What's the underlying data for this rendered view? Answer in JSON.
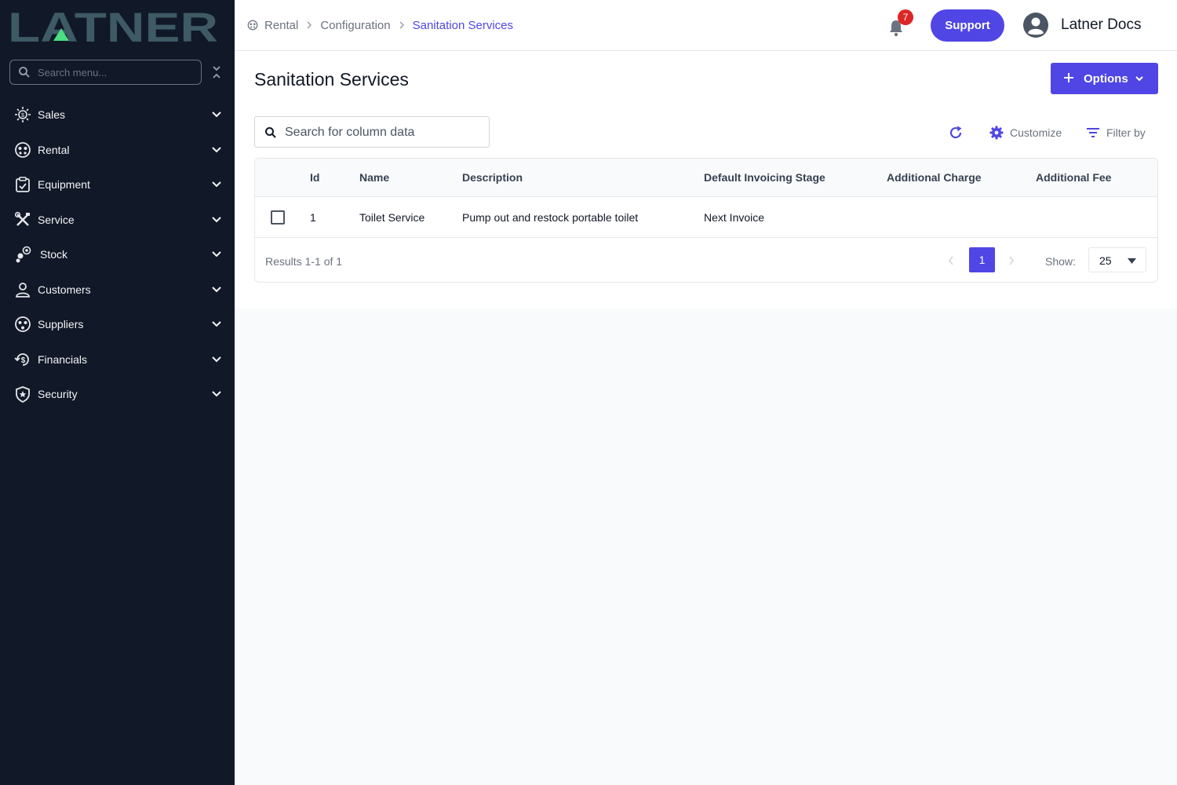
{
  "app": {
    "logo_text": "LATNER"
  },
  "colors": {
    "sidebar_bg": "#111827",
    "accent": "#4f46e5",
    "badge": "#dc2626",
    "logo": "#3d5a65",
    "logo_accent": "#4ade80"
  },
  "sidebar": {
    "search_placeholder": "Search menu...",
    "items": [
      {
        "label": "Sales",
        "icon": "sales-icon"
      },
      {
        "label": "Rental",
        "icon": "rental-icon"
      },
      {
        "label": "Equipment",
        "icon": "equipment-icon"
      },
      {
        "label": "Service",
        "icon": "service-tools-icon"
      },
      {
        "label": "Stock",
        "icon": "stock-icon"
      },
      {
        "label": "Customers",
        "icon": "person-icon"
      },
      {
        "label": "Suppliers",
        "icon": "suppliers-icon"
      },
      {
        "label": "Financials",
        "icon": "financials-icon"
      },
      {
        "label": "Security",
        "icon": "shield-icon"
      }
    ]
  },
  "header": {
    "breadcrumbs": [
      "Rental",
      "Configuration",
      "Sanitation Services"
    ],
    "notification_count": "7",
    "support_label": "Support",
    "user_name": "Latner Docs"
  },
  "main": {
    "title": "Sanitation Services",
    "options_label": "Options",
    "search_placeholder": "Search for column data",
    "customize_label": "Customize",
    "filter_label": "Filter by"
  },
  "table": {
    "columns": [
      "Id",
      "Name",
      "Description",
      "Default Invoicing Stage",
      "Additional Charge",
      "Additional Fee"
    ],
    "rows": [
      {
        "id": "1",
        "name": "Toilet Service",
        "description": "Pump out and restock portable toilet",
        "invoicing_stage": "Next Invoice",
        "additional_charge": "",
        "additional_fee": ""
      }
    ]
  },
  "pagination": {
    "results_text": "Results 1-1 of 1",
    "current_page": "1",
    "show_label": "Show:",
    "page_size": "25"
  }
}
